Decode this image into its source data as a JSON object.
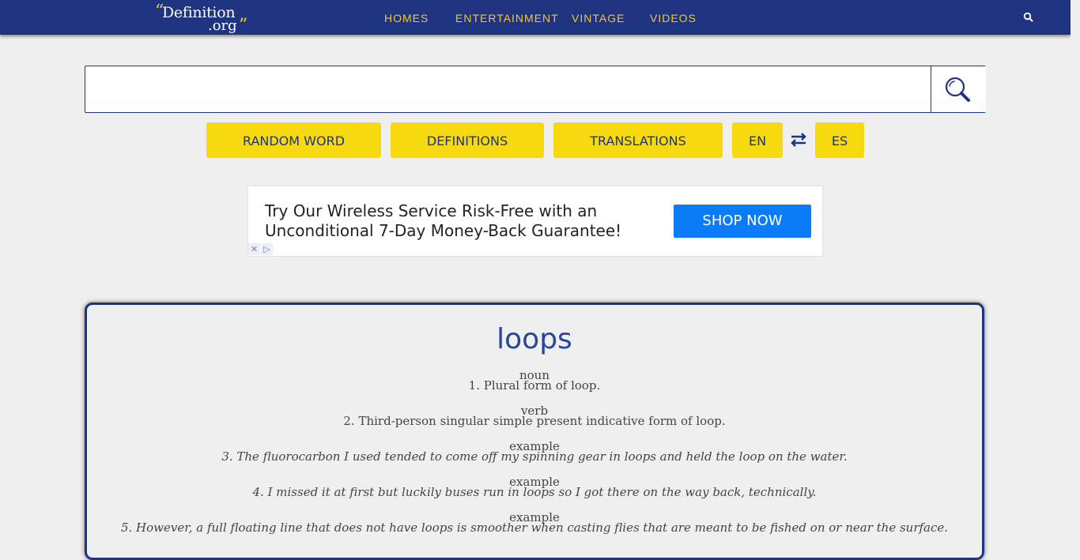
{
  "header": {
    "logo": {
      "open_quote": "“",
      "word": "Definition",
      "ext": ".org",
      "close_quote": "”"
    },
    "nav": [
      "HOMES",
      "ENTERTAINMENT",
      "VINTAGE",
      "VIDEOS"
    ],
    "search_icon": "search-icon",
    "bg_color": "#1e3480",
    "accent_color": "#f2c43a"
  },
  "search": {
    "value": "",
    "placeholder": "",
    "button_icon": "magnifier-icon"
  },
  "actions": {
    "random_word": "RANDOM WORD",
    "definitions": "DEFINITIONS",
    "translations": "TRANSLATIONS",
    "lang_from": "EN",
    "swap_icon": "swap-arrows-icon",
    "lang_to": "ES",
    "button_color": "#f6d90f"
  },
  "ad": {
    "text": "Try Our Wireless Service Risk-Free with an Unconditional 7-Day Money-Back Guarantee!",
    "cta": "SHOP NOW",
    "close_glyph": "✕",
    "adchoices_glyph": "▷"
  },
  "entry": {
    "word": "loops",
    "definitions": [
      {
        "pos": "noun",
        "text": "1. Plural form of loop.",
        "italic": false
      },
      {
        "pos": "verb",
        "text": "2. Third-person singular simple present indicative form of loop.",
        "italic": false
      },
      {
        "pos": "example",
        "text": "3. The fluorocarbon I used tended to come off my spinning gear in loops and held the loop on the water.",
        "italic": true
      },
      {
        "pos": "example",
        "text": "4. I missed it at first but luckily buses run in loops so I got there on the way back, technically.",
        "italic": true
      },
      {
        "pos": "example",
        "text": "5. However, a full floating line that does not have loops is smoother when casting flies that are meant to be fished on or near the surface.",
        "italic": true
      }
    ]
  }
}
